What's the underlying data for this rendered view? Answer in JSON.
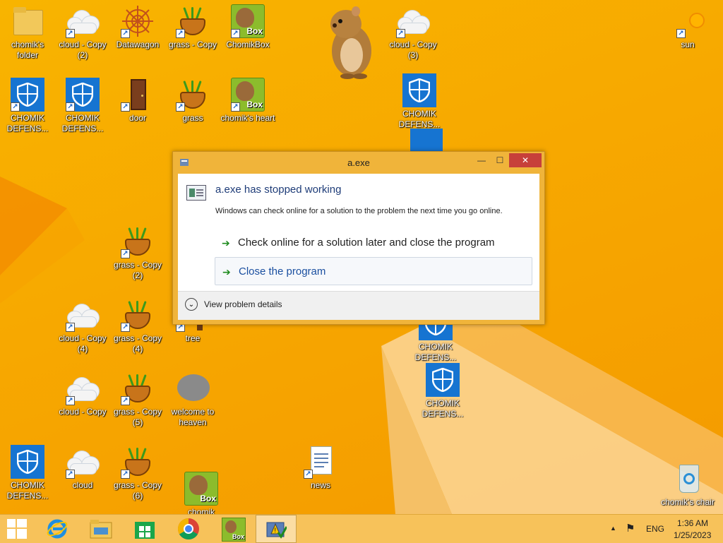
{
  "desktop": {
    "icons": [
      {
        "label": "chomik's folder"
      },
      {
        "label": "cloud - Copy (2)"
      },
      {
        "label": "Datawagon"
      },
      {
        "label": "grass - Copy"
      },
      {
        "label": "ChomikBox"
      },
      {
        "label": "cloud - Copy (3)"
      },
      {
        "label": "sun"
      },
      {
        "label": "CHOMIK DEFENS..."
      },
      {
        "label": "CHOMIK DEFENS..."
      },
      {
        "label": "door"
      },
      {
        "label": "grass"
      },
      {
        "label": "chomik's heart"
      },
      {
        "label": "CHOMIK DEFENS..."
      },
      {
        "label": "grass - Copy (2)"
      },
      {
        "label": "cloud - Copy (4)"
      },
      {
        "label": "grass - Copy (4)"
      },
      {
        "label": "tree"
      },
      {
        "label": "CHOMIK DEFENS..."
      },
      {
        "label": "CHOMIK DEFENS..."
      },
      {
        "label": "cloud - Copy"
      },
      {
        "label": "grass - Copy (5)"
      },
      {
        "label": "welcome to heaven"
      },
      {
        "label": "CHOMIK DEFENS..."
      },
      {
        "label": "cloud"
      },
      {
        "label": "grass - Copy (6)"
      },
      {
        "label": "chomik"
      },
      {
        "label": "news"
      },
      {
        "label": "chomik's chair"
      }
    ]
  },
  "dialog": {
    "title": "a.exe",
    "heading": "a.exe has stopped working",
    "message": "Windows can check online for a solution to the problem the next time you go online.",
    "option_check": "Check online for a solution later and close the program",
    "option_close": "Close the program",
    "details": "View problem details",
    "close_glyph": "✕",
    "min_glyph": "—",
    "max_glyph": "☐"
  },
  "taskbar": {
    "lang": "ENG",
    "time": "1:36 AM",
    "date": "1/25/2023",
    "box_text": "Box",
    "tray_arrow": "▲",
    "tray_flag": "⚑"
  },
  "colors": {
    "desktop": "#f7a800",
    "dialog_frame": "#f0b43a",
    "close_button": "#c7403a",
    "accent_blue": "#1674d1"
  }
}
